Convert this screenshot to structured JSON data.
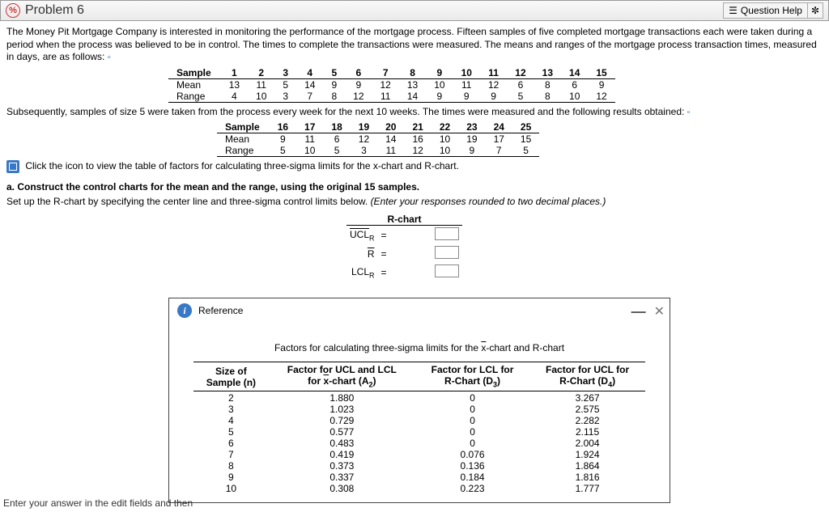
{
  "header": {
    "problem_label": "Problem 6",
    "icon_text": "%",
    "help_label": "Question Help"
  },
  "intro_para": "The Money Pit Mortgage Company is interested in monitoring the performance of the mortgage process. Fifteen samples of five completed mortgage transactions each were taken during a period when the process was believed to be in control. The times to complete the transactions were measured. The means and ranges of the mortgage process transaction times, measured in days, are as follows:",
  "table1": {
    "headers": [
      "Sample",
      "1",
      "2",
      "3",
      "4",
      "5",
      "6",
      "7",
      "8",
      "9",
      "10",
      "11",
      "12",
      "13",
      "14",
      "15"
    ],
    "rows": [
      [
        "Mean",
        "13",
        "11",
        "5",
        "14",
        "9",
        "9",
        "12",
        "13",
        "10",
        "11",
        "12",
        "6",
        "8",
        "6",
        "9"
      ],
      [
        "Range",
        "4",
        "10",
        "3",
        "7",
        "8",
        "12",
        "11",
        "14",
        "9",
        "9",
        "9",
        "5",
        "8",
        "10",
        "12"
      ]
    ]
  },
  "subsequent_para": "Subsequently, samples of size 5 were taken from the process every week for the next 10 weeks. The times were measured and the following results obtained:",
  "table2": {
    "headers": [
      "Sample",
      "16",
      "17",
      "18",
      "19",
      "20",
      "21",
      "22",
      "23",
      "24",
      "25"
    ],
    "rows": [
      [
        "Mean",
        "9",
        "11",
        "6",
        "12",
        "14",
        "16",
        "10",
        "19",
        "17",
        "15"
      ],
      [
        "Range",
        "5",
        "10",
        "5",
        "3",
        "11",
        "12",
        "10",
        "9",
        "7",
        "5"
      ]
    ]
  },
  "link_text": "Click the icon to view the table of factors for calculating three-sigma limits for the x-chart and R-chart.",
  "part_a": "a. Construct the control charts for the mean and the range, using the original 15 samples.",
  "setup_text": "Set up the R-chart by specifying the center line and three-sigma control limits below. (Enter your responses rounded to two decimal places.)",
  "rchart": {
    "title": "R-chart",
    "ucl_label": "UCL",
    "r_label": "R",
    "lcl_label": "LCL",
    "sub": "R",
    "eq": "="
  },
  "reference": {
    "title": "Reference",
    "caption": "Factors for calculating three-sigma limits for the x-chart and R-chart",
    "col1": "Size of",
    "col1b": "Sample (n)",
    "col2": "Factor for UCL and LCL",
    "col2b": "for x-chart (A₂)",
    "col3": "Factor for LCL for",
    "col3b": "R-Chart (D₃)",
    "col4": "Factor for UCL for",
    "col4b": "R-Chart (D₄)",
    "rows": [
      [
        "2",
        "1.880",
        "0",
        "3.267"
      ],
      [
        "3",
        "1.023",
        "0",
        "2.575"
      ],
      [
        "4",
        "0.729",
        "0",
        "2.282"
      ],
      [
        "5",
        "0.577",
        "0",
        "2.115"
      ],
      [
        "6",
        "0.483",
        "0",
        "2.004"
      ],
      [
        "7",
        "0.419",
        "0.076",
        "1.924"
      ],
      [
        "8",
        "0.373",
        "0.136",
        "1.864"
      ],
      [
        "9",
        "0.337",
        "0.184",
        "1.816"
      ],
      [
        "10",
        "0.308",
        "0.223",
        "1.777"
      ]
    ]
  },
  "footer": "Enter your answer in the edit fields and then"
}
